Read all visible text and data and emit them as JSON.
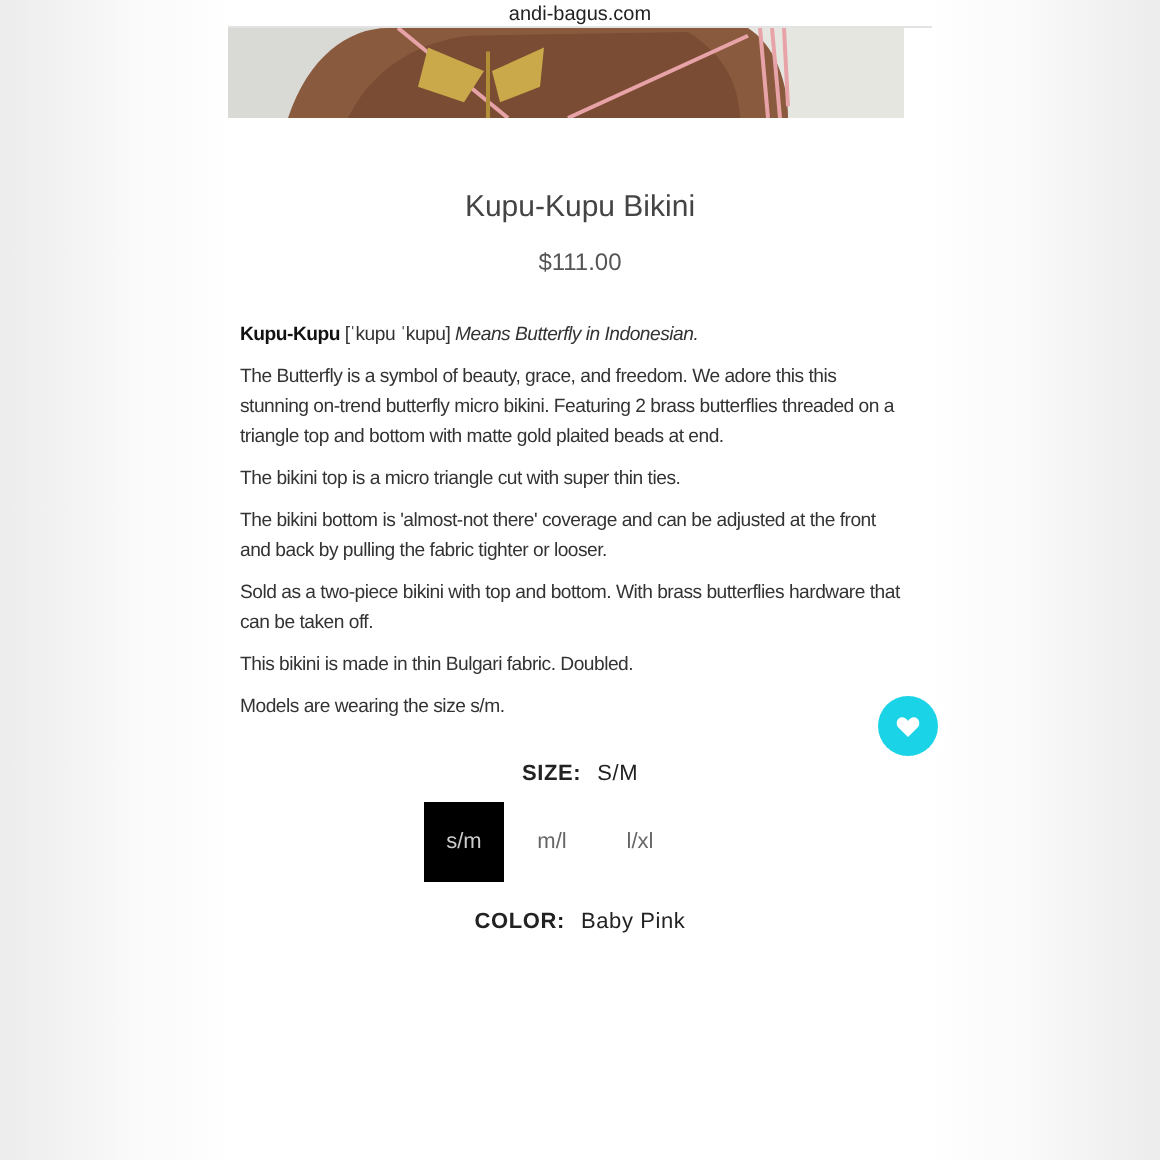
{
  "address_bar": {
    "url": "andi-bagus.com"
  },
  "product": {
    "title": "Kupu-Kupu Bikini",
    "price": "$111.00"
  },
  "description": [
    "**Kupu-Kupu** [ˈkupu ˈkupu]  *Means Butterfly in Indonesian.*",
    "The Butterfly is a symbol of beauty, grace, and freedom. We adore this this stunning on-trend butterfly micro bikini. Featuring 2 brass butterflies threaded on a triangle top and bottom with matte gold plaited beads at end.",
    "The bikini top is a micro triangle cut with super thin ties.",
    "The bikini bottom is 'almost-not there' coverage and can be adjusted at the front and back by pulling the fabric tighter or looser.",
    "Sold as a two-piece bikini with top and bottom. With brass butterflies hardware that can be taken off.",
    "This bikini is made in thin Bulgari fabric. Doubled.",
    "Models are wearing the size s/m."
  ],
  "size": {
    "label": "SIZE:",
    "value": "S/M",
    "options": [
      {
        "label": "s/m",
        "selected": true
      },
      {
        "label": "m/l",
        "selected": false
      },
      {
        "label": "l/xl",
        "selected": false
      }
    ]
  },
  "color": {
    "label": "COLOR:",
    "value": "Baby Pink"
  }
}
